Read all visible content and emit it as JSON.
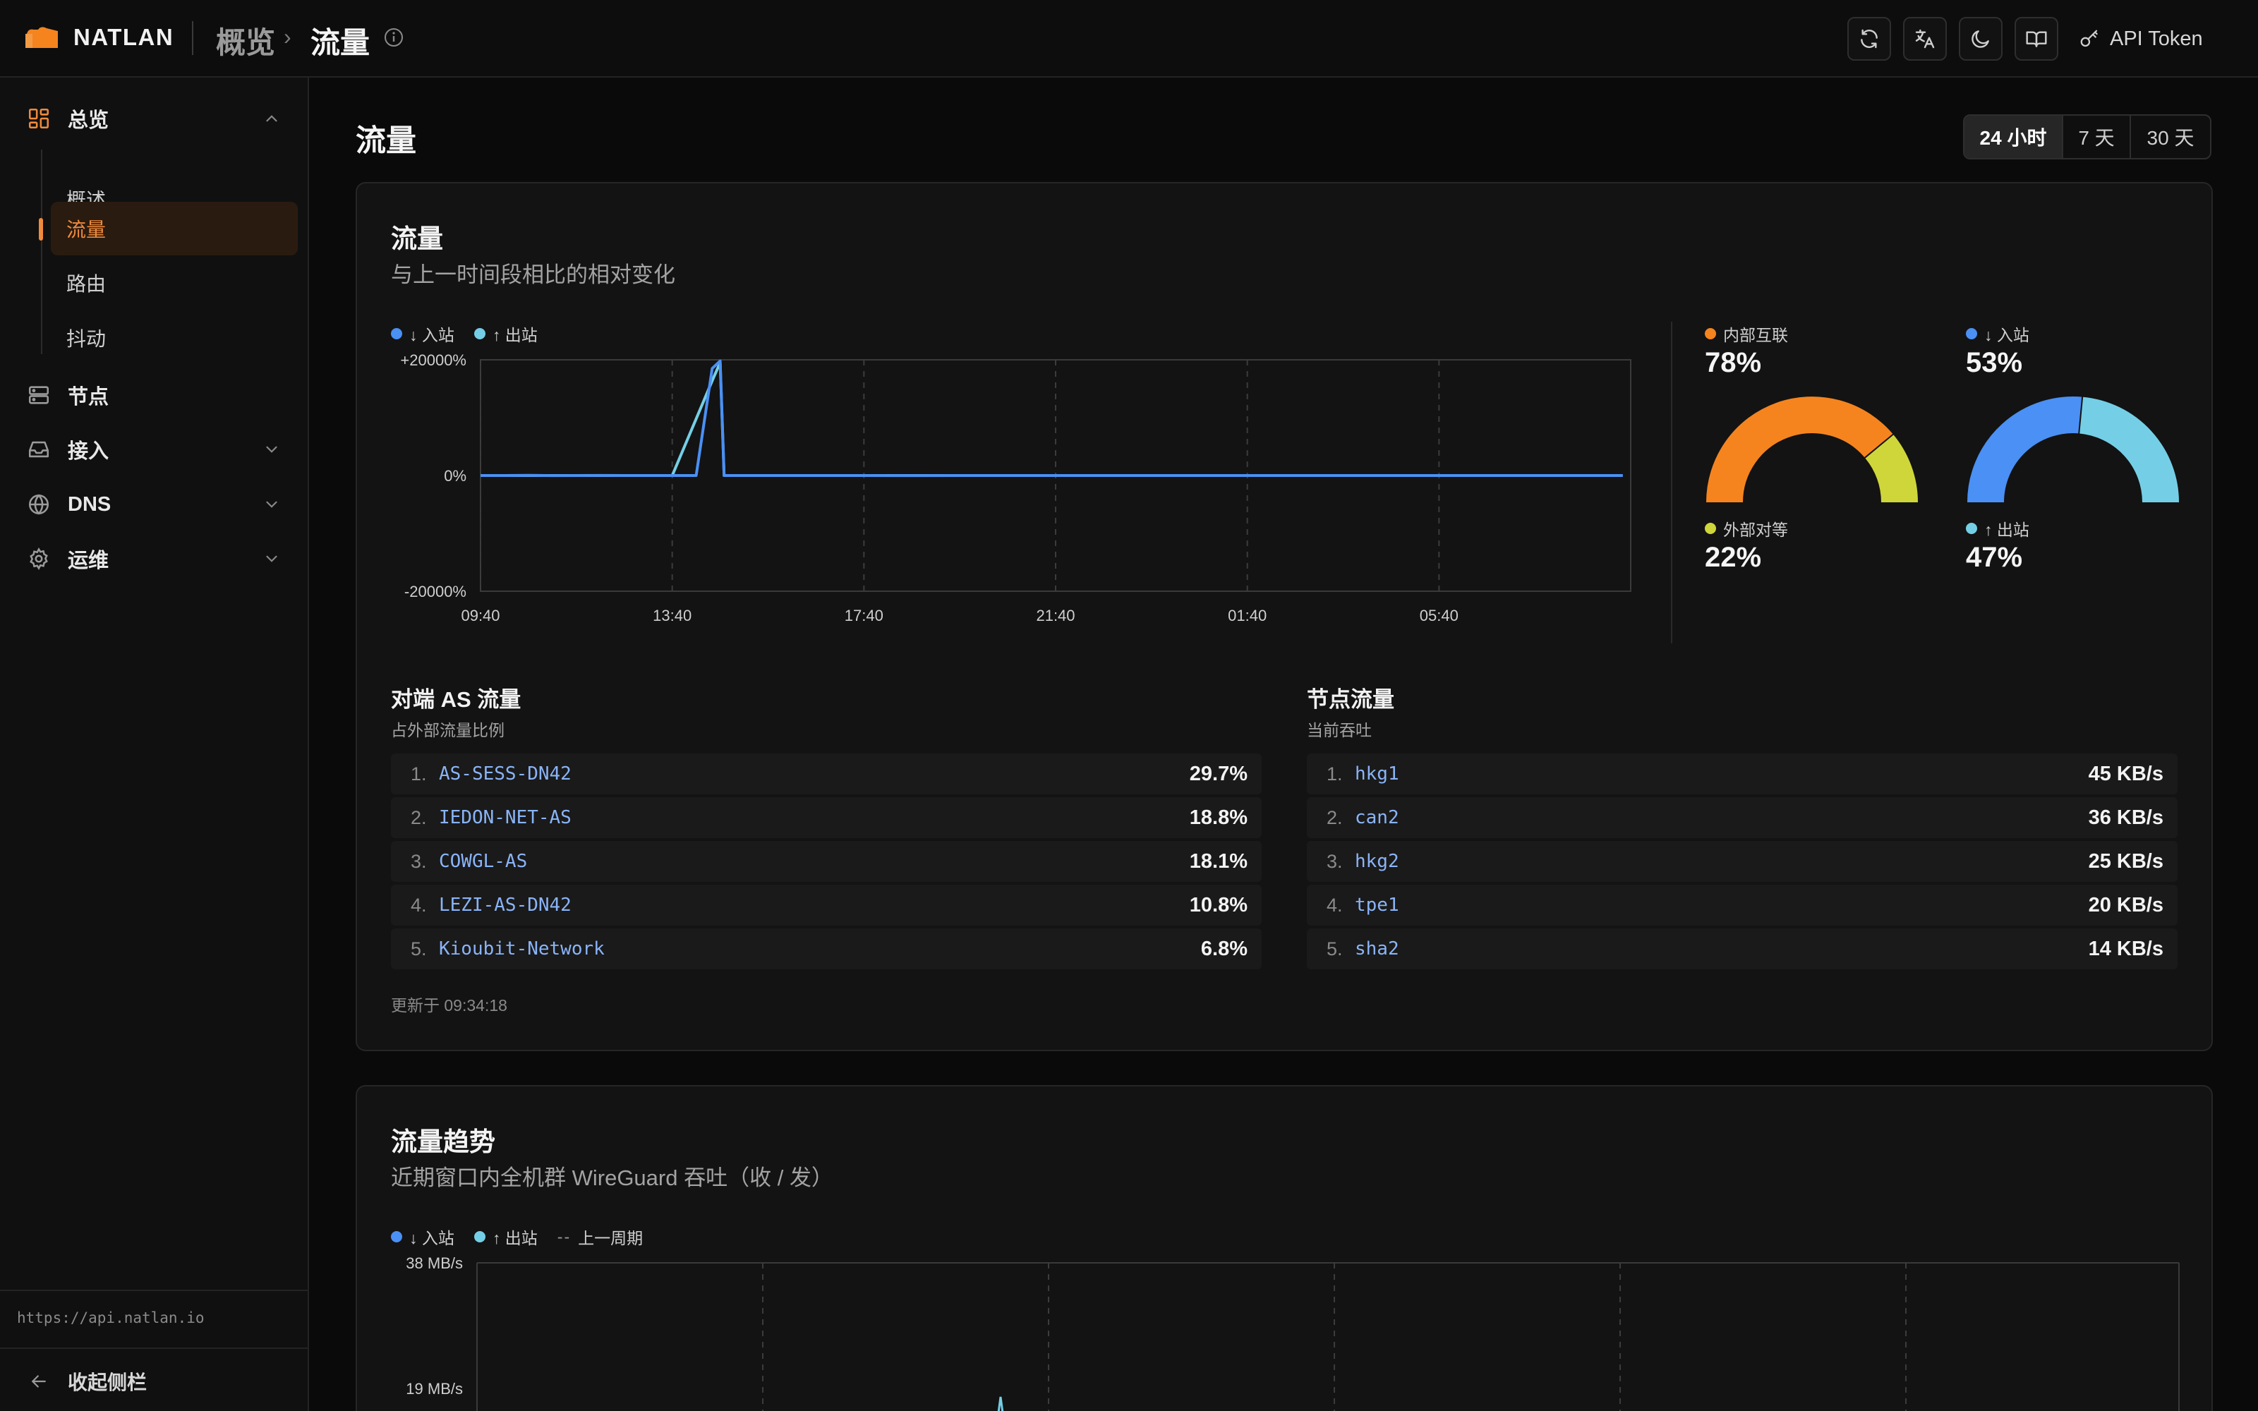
{
  "header": {
    "brand": "NATLAN",
    "breadcrumb_parent": "概览",
    "breadcrumb_current": "流量",
    "api_token_label": "API Token",
    "toolbar_icons": [
      "refresh-icon",
      "translate-icon",
      "moon-icon",
      "book-icon",
      "key-icon"
    ]
  },
  "sidebar": {
    "items": [
      {
        "label": "总览",
        "icon": "dashboard-icon",
        "expanded": true
      },
      {
        "label": "节点",
        "icon": "server-icon"
      },
      {
        "label": "接入",
        "icon": "inbox-icon",
        "expanded": false
      },
      {
        "label": "DNS",
        "icon": "globe-icon",
        "expanded": false
      },
      {
        "label": "运维",
        "icon": "gear-icon",
        "expanded": false
      }
    ],
    "subitems": [
      {
        "label": "概述"
      },
      {
        "label": "流量",
        "active": true
      },
      {
        "label": "路由"
      },
      {
        "label": "抖动"
      }
    ],
    "api_url": "https://api.natlan.io",
    "collapse_label": "收起侧栏"
  },
  "page": {
    "title": "流量",
    "range_options": [
      "24 小时",
      "7 天",
      "30 天"
    ],
    "range_selected": "24 小时"
  },
  "traffic_card": {
    "title": "流量",
    "subtitle": "与上一时间段相比的相对变化",
    "legend": {
      "inbound": "↓ 入站",
      "outbound": "↑ 出站"
    },
    "gauges": {
      "internal_label": "内部互联",
      "internal_value": "78%",
      "external_label": "外部对等",
      "external_value": "22%",
      "inbound_label": "↓ 入站",
      "inbound_value": "53%",
      "outbound_label": "↑ 出站",
      "outbound_value": "47%"
    },
    "as_list": {
      "title": "对端 AS 流量",
      "subtitle": "占外部流量比例",
      "items": [
        {
          "num": "1.",
          "name": "AS-SESS-DN42",
          "value": "29.7%"
        },
        {
          "num": "2.",
          "name": "IEDON-NET-AS",
          "value": "18.8%"
        },
        {
          "num": "3.",
          "name": "COWGL-AS",
          "value": "18.1%"
        },
        {
          "num": "4.",
          "name": "LEZI-AS-DN42",
          "value": "10.8%"
        },
        {
          "num": "5.",
          "name": "Kioubit-Network",
          "value": "6.8%"
        }
      ]
    },
    "node_list": {
      "title": "节点流量",
      "subtitle": "当前吞吐",
      "items": [
        {
          "num": "1.",
          "name": "hkg1",
          "value": "45 KB/s"
        },
        {
          "num": "2.",
          "name": "can2",
          "value": "36 KB/s"
        },
        {
          "num": "3.",
          "name": "hkg2",
          "value": "25 KB/s"
        },
        {
          "num": "4.",
          "name": "tpe1",
          "value": "20 KB/s"
        },
        {
          "num": "5.",
          "name": "sha2",
          "value": "14 KB/s"
        }
      ]
    },
    "updated": "更新于 09:34:18"
  },
  "trend_card": {
    "title": "流量趋势",
    "subtitle": "近期窗口内全机群 WireGuard 吞吐（收 / 发）",
    "legend": {
      "inbound": "↓ 入站",
      "outbound": "↑ 出站",
      "previous": "上一周期"
    }
  },
  "colors": {
    "accent": "#f08a3c",
    "inbound": "#4a90f5",
    "outbound": "#74cfe6",
    "internal": "#f5841f",
    "external": "#cfd63a"
  },
  "chart_data": [
    {
      "type": "line",
      "title": "",
      "ylabel": "",
      "ylim": [
        -20000,
        20000
      ],
      "y_ticks": [
        "+20000%",
        "0%",
        "-20000%"
      ],
      "x_ticks": [
        "09:40",
        "13:40",
        "17:40",
        "21:40",
        "01:40",
        "05:40"
      ],
      "series": [
        {
          "name": "↓ 入站",
          "points": [
            [
              0,
              0
            ],
            [
              30,
              0
            ],
            [
              60,
              20
            ],
            [
              90,
              -10
            ],
            [
              120,
              0
            ],
            [
              150,
              15
            ],
            [
              180,
              0
            ],
            [
              210,
              -5
            ],
            [
              240,
              0
            ],
            [
              270,
              0
            ],
            [
              290,
              18500
            ],
            [
              300,
              19800
            ],
            [
              305,
              0
            ],
            [
              330,
              0
            ],
            [
              360,
              0
            ],
            [
              420,
              0
            ],
            [
              480,
              0
            ],
            [
              540,
              -15
            ],
            [
              600,
              0
            ],
            [
              660,
              0
            ],
            [
              720,
              0
            ],
            [
              780,
              0
            ],
            [
              840,
              0
            ],
            [
              900,
              0
            ],
            [
              960,
              0
            ],
            [
              1020,
              0
            ],
            [
              1080,
              0
            ],
            [
              1140,
              0
            ],
            [
              1200,
              0
            ],
            [
              1260,
              0
            ],
            [
              1320,
              0
            ],
            [
              1380,
              0
            ],
            [
              1430,
              0
            ]
          ]
        },
        {
          "name": "↑ 出站",
          "points": [
            [
              0,
              0
            ],
            [
              120,
              0
            ],
            [
              240,
              0
            ],
            [
              292,
              17000
            ],
            [
              300,
              19500
            ],
            [
              305,
              0
            ],
            [
              420,
              0
            ],
            [
              600,
              0
            ],
            [
              900,
              0
            ],
            [
              1200,
              0
            ],
            [
              1430,
              0
            ]
          ]
        }
      ]
    },
    {
      "type": "pie",
      "title": "",
      "slices": [
        {
          "label": "内部互联",
          "value": 78
        },
        {
          "label": "外部对等",
          "value": 22
        }
      ]
    },
    {
      "type": "pie",
      "title": "",
      "slices": [
        {
          "label": "↓ 入站",
          "value": 53
        },
        {
          "label": "↑ 出站",
          "value": 47
        }
      ]
    },
    {
      "type": "line",
      "title": "",
      "y_ticks": [
        "38 MB/s",
        "19 MB/s"
      ],
      "series": [
        {
          "name": "↓ 入站",
          "points": []
        },
        {
          "name": "↑ 出站",
          "points": []
        }
      ]
    }
  ]
}
